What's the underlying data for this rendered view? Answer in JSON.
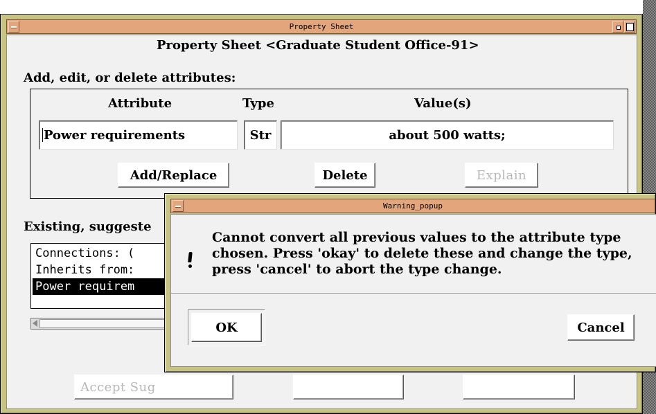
{
  "main_window": {
    "title": "Property Sheet",
    "header": "Property Sheet <Graduate Student Office-91>",
    "section_label": "Add, edit, or delete attributes:",
    "col_attribute": "Attribute",
    "col_type": "Type",
    "col_values": "Value(s)",
    "attribute_value": "Power requirements",
    "type_value": "Str",
    "values_value": "about 500 watts;",
    "add_replace_label": "Add/Replace",
    "delete_label": "Delete",
    "explain_label": "Explain",
    "existing_label": "Existing, suggeste",
    "list_items": [
      "Connections: (",
      "Inherits from:",
      "Power requirem"
    ],
    "accept_label": "Accept Sug"
  },
  "warning_popup": {
    "title": "Warning_popup",
    "message_line1": "Cannot convert all previous values to the attribute type",
    "message_line2": "chosen. Press 'okay' to delete these and change the type,",
    "message_line3": "press 'cancel' to abort the type change.",
    "ok_label": "OK",
    "cancel_label": "Cancel"
  },
  "colors": {
    "titlebar": "#e3a57b",
    "frame": "#c7c483",
    "selection": "#000000"
  }
}
